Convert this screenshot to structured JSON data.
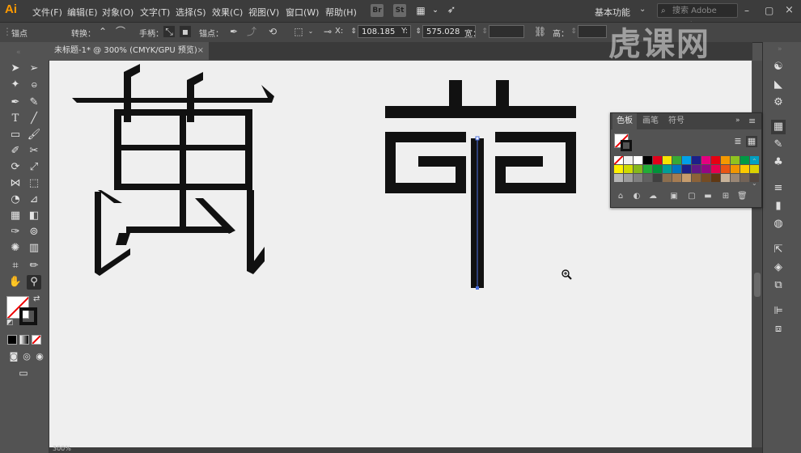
{
  "app": {
    "logo": "Ai"
  },
  "menu": [
    "文件(F)",
    "编辑(E)",
    "对象(O)",
    "文字(T)",
    "选择(S)",
    "效果(C)",
    "视图(V)",
    "窗口(W)",
    "帮助(H)"
  ],
  "appbar_icons": {
    "br": "Br",
    "st": "St"
  },
  "workspace": "基本功能",
  "search": {
    "placeholder": "搜索 Adobe Stock"
  },
  "control": {
    "anchor_label": "锚点",
    "convert_label": "转换：",
    "handle_label": "手柄：",
    "anchors_label": "锚点：",
    "x_label": "X:",
    "x_value": "108.185",
    "y_label": "Y:",
    "y_value": "575.028",
    "w_label": "宽：",
    "h_label": "高："
  },
  "document": {
    "tab_title": "未标题-1* @ 300% (CMYK/GPU 预览)",
    "close": "×"
  },
  "panel": {
    "tabs": [
      "色板",
      "画笔",
      "符号"
    ],
    "menu_glyph": "≡",
    "swatches": [
      "#ffffff",
      "#f0f0f0",
      "#ffffff",
      "#000000",
      "#e1001a",
      "#f7e400",
      "#38a935",
      "#00a0e9",
      "#1d2088",
      "#e4007f",
      "#e60012",
      "#f39800",
      "#8fc31f",
      "#009944",
      "#00a0c1",
      "#fff100",
      "#cfdb00",
      "#86b81b",
      "#22ac38",
      "#00913a",
      "#009e96",
      "#0075c2",
      "#1d2088",
      "#601986",
      "#920783",
      "#e5004f",
      "#e95513",
      "#f29600",
      "#fcc800",
      "#ddd000",
      "#b5b5b5",
      "#9c9c9c",
      "#7f7f7f",
      "#606060",
      "#404040",
      "#8b6e4e",
      "#a67c52",
      "#c69c6d",
      "#8c6239",
      "#754c24",
      "#603813",
      "#c7b299",
      "#998675",
      "#736357",
      "#534741"
    ]
  },
  "status": {
    "zoom": "300%"
  },
  "watermark": "虎课网"
}
